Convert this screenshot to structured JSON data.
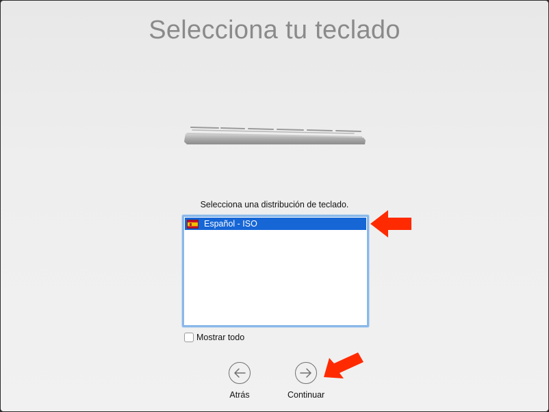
{
  "title": "Selecciona tu teclado",
  "prompt": "Selecciona una distribución de teclado.",
  "layouts": [
    {
      "label": "Español - ISO",
      "selected": true,
      "flag": "spain-flag"
    }
  ],
  "show_all": {
    "label": "Mostrar todo",
    "checked": false
  },
  "nav": {
    "back_label": "Atrás",
    "continue_label": "Continuar"
  },
  "colors": {
    "selection": "#1666d6",
    "focus_ring": "#8ab8e8",
    "annotation_arrow": "#ff2a00",
    "title": "#8a8a8a"
  },
  "icons": {
    "back": "arrow-left-circle-icon",
    "continue": "arrow-right-circle-icon",
    "keyboard": "keyboard-illustration"
  }
}
